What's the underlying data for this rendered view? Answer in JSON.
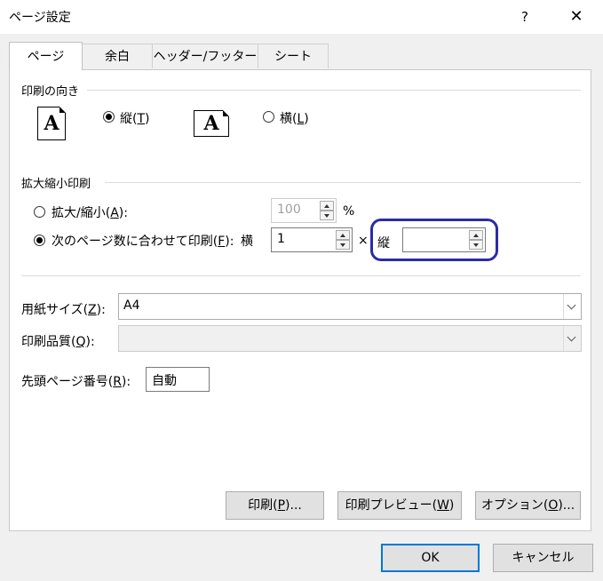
{
  "window": {
    "title": "ページ設定",
    "help": "?",
    "close": "✕"
  },
  "tabs": [
    {
      "label": "ページ"
    },
    {
      "label": "余白"
    },
    {
      "label": "ヘッダー/フッター"
    },
    {
      "label": "シート"
    }
  ],
  "orientation": {
    "section_label": "印刷の向き",
    "portrait": {
      "label_pre": "縦(",
      "key": "T",
      "label_post": ")",
      "checked": true,
      "icon_glyph": "A"
    },
    "landscape": {
      "label_pre": "横(",
      "key": "L",
      "label_post": ")",
      "checked": false,
      "icon_glyph": "A"
    }
  },
  "scaling": {
    "section_label": "拡大縮小印刷",
    "adjust": {
      "label_pre": "拡大/縮小(",
      "key": "A",
      "label_post": "):",
      "value": "100",
      "unit": "%",
      "checked": false
    },
    "fit": {
      "label_pre": "次のページ数に合わせて印刷(",
      "key": "F",
      "label_post": "):",
      "checked": true,
      "wide_label": "横",
      "wide_value": "1",
      "times": "×",
      "tall_label": "縦",
      "tall_value": ""
    }
  },
  "paper_size": {
    "label_pre": "用紙サイズ(",
    "key": "Z",
    "label_post": "):",
    "value": "A4"
  },
  "print_quality": {
    "label_pre": "印刷品質(",
    "key": "Q",
    "label_post": "):",
    "value": ""
  },
  "first_page": {
    "label_pre": "先頭ページ番号(",
    "key": "R",
    "label_post": "):",
    "value": "自動"
  },
  "buttons": {
    "print": {
      "label_pre": "印刷(",
      "key": "P",
      "label_post": ")..."
    },
    "preview": {
      "label_pre": "印刷プレビュー(",
      "key": "W",
      "label_post": ")"
    },
    "options": {
      "label_pre": "オプション(",
      "key": "O",
      "label_post": ")..."
    },
    "ok": "OK",
    "cancel": "キャンセル"
  },
  "colors": {
    "highlight": "#2b2ba8",
    "default_button_border": "#0078d7"
  }
}
